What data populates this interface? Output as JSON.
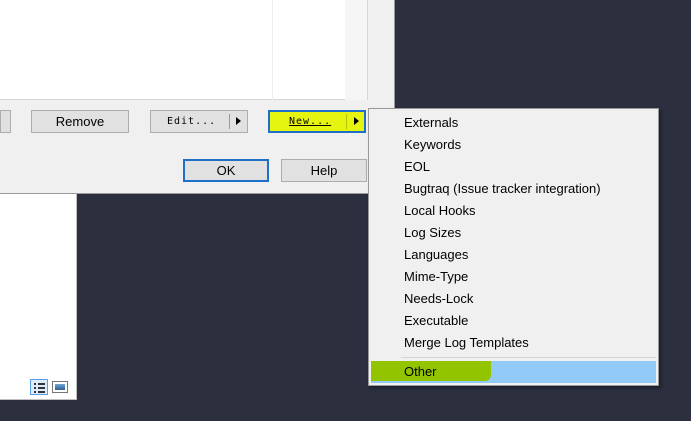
{
  "dialog": {
    "buttons": {
      "remove": "Remove",
      "edit": "Edit...",
      "new": "New...",
      "ok": "OK",
      "help": "Help"
    }
  },
  "menu": {
    "items": [
      "Externals",
      "Keywords",
      "EOL",
      "Bugtraq (Issue tracker integration)",
      "Local Hooks",
      "Log Sizes",
      "Languages",
      "Mime-Type",
      "Needs-Lock",
      "Executable",
      "Merge Log Templates"
    ],
    "highlighted_item": "Other"
  },
  "colors": {
    "desktop": "#2b2f3e",
    "new_button_highlight": "#e6f510",
    "menu_hover": "#91c9f7",
    "other_marker": "#93c400",
    "focus_border": "#1e6fc8"
  }
}
